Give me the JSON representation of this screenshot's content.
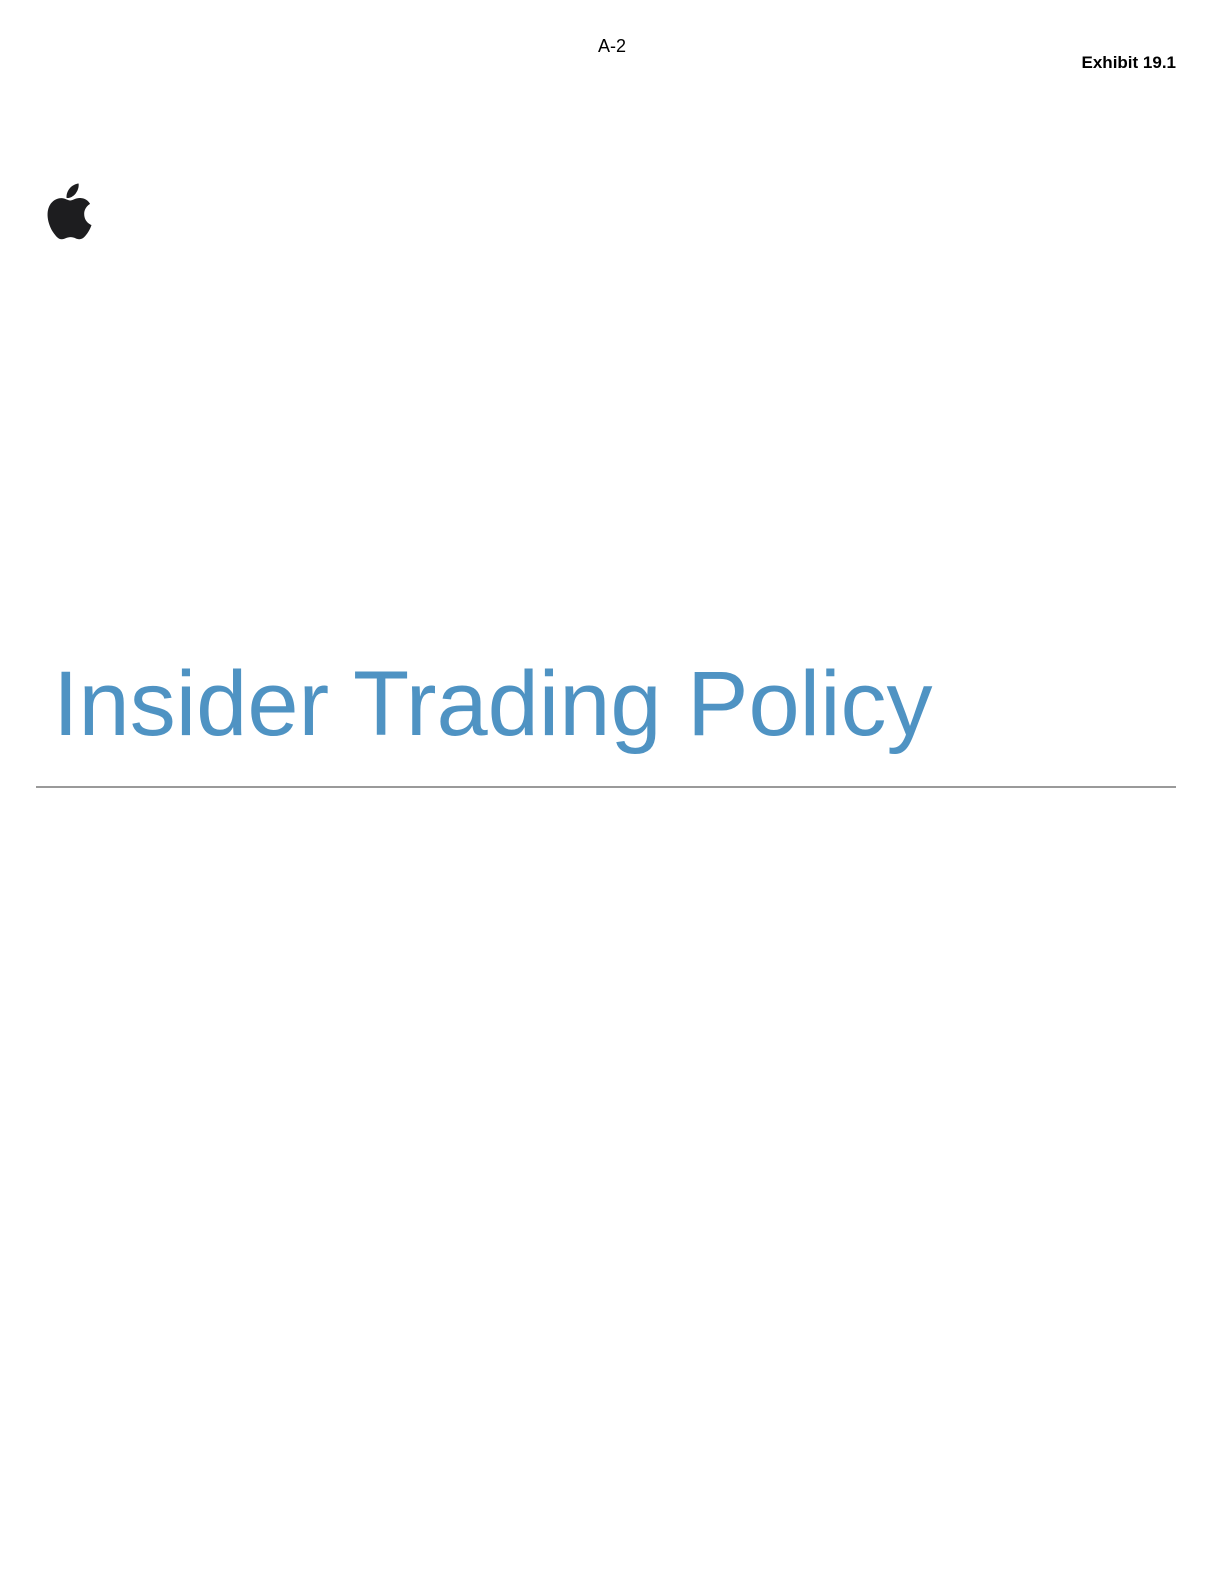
{
  "header": {
    "page_number": "A-2",
    "exhibit": "Exhibit 19.1"
  },
  "logo": {
    "icon": "apple-logo-icon",
    "color": "#1d1d1f"
  },
  "cover": {
    "title": "Insider Trading Policy",
    "title_color": "#4f93c3",
    "rule_color": "#9a9a9a"
  }
}
